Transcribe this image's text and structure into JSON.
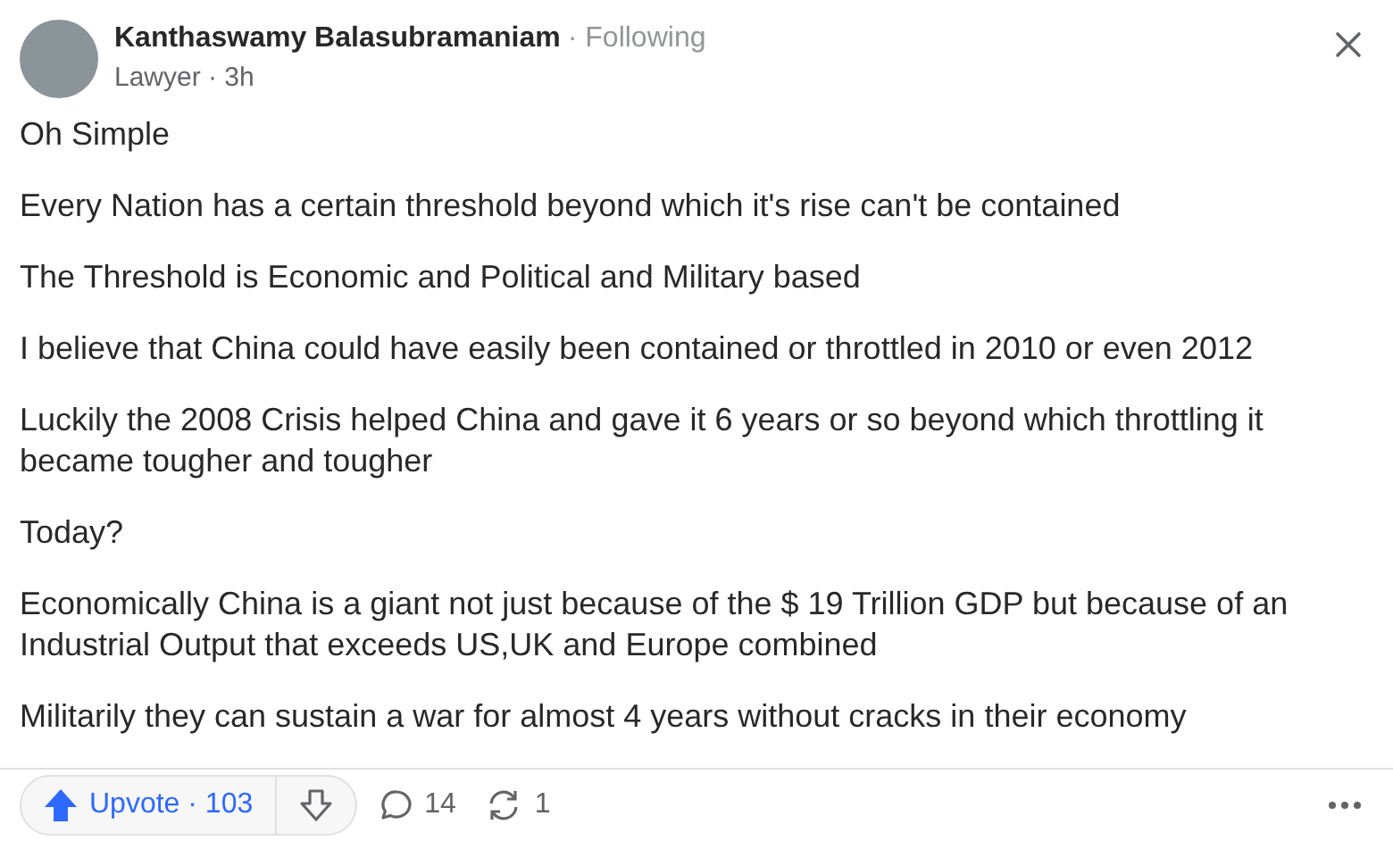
{
  "author": {
    "name": "Kanthaswamy Balasubramaniam",
    "follow_status": "· Following",
    "credential": "Lawyer · 3h"
  },
  "paragraphs": [
    "Oh Simple",
    "Every Nation has a certain threshold beyond which it's rise can't be contained",
    "The Threshold is Economic and Political and Military based",
    "I believe that China could have easily been contained or throttled in 2010 or even 2012",
    "Luckily the 2008 Crisis helped China and gave it 6 years or so beyond which throttling it became tougher and tougher",
    "Today?",
    "Economically China is a giant not just because of the $ 19 Trillion GDP but because of an Industrial Output that exceeds US,UK and Europe combined",
    "Militarily they can sustain a war for almost 4 years without cracks in their economy"
  ],
  "actions": {
    "upvote": "Upvote · 103",
    "comments": "14",
    "shares": "1"
  }
}
